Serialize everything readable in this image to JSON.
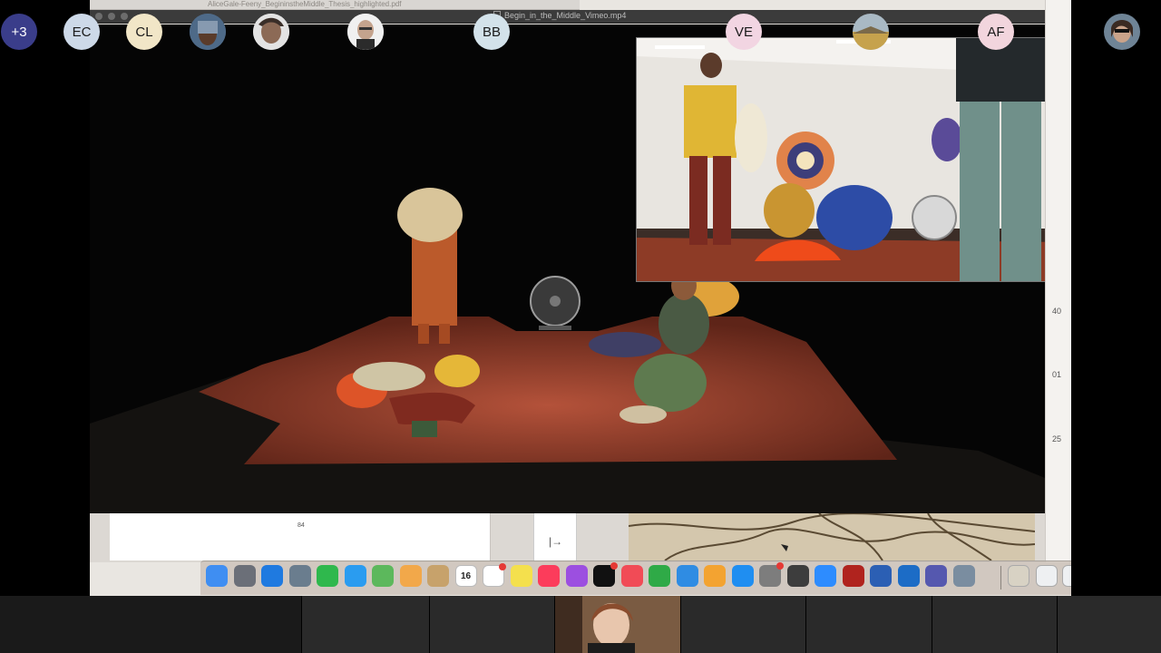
{
  "pdf_window": {
    "title": "AliceGale-Feeny_BegininstheMiddle_Thesis_highlighted.pdf"
  },
  "video_window": {
    "title": "Begin_in_the_Middle_Vimeo.mp4"
  },
  "pdf": {
    "page_number": "84",
    "side_numbers": [
      "40",
      "01",
      "25"
    ],
    "toolbar_glyph": "|→"
  },
  "dock": {
    "calendar_day": "16",
    "apps": [
      {
        "name": "Finder",
        "color": "#3f8ef2"
      },
      {
        "name": "Launchpad",
        "color": "#6b6f78"
      },
      {
        "name": "Safari",
        "color": "#1f7ae0"
      },
      {
        "name": "Preview",
        "color": "#6a7d8e"
      },
      {
        "name": "FaceTime",
        "color": "#2fb84d"
      },
      {
        "name": "Messages",
        "color": "#2a9cf0"
      },
      {
        "name": "Maps",
        "color": "#5cb85c"
      },
      {
        "name": "Photos",
        "color": "#f2a84a"
      },
      {
        "name": "Notes app",
        "color": "#c7a26b"
      },
      {
        "name": "Calendar",
        "color": "#ffffff"
      },
      {
        "name": "Reminders",
        "color": "#ffffff"
      },
      {
        "name": "Stickies",
        "color": "#f4e04d"
      },
      {
        "name": "Music",
        "color": "#fc3c5b"
      },
      {
        "name": "Podcasts",
        "color": "#9c4fe0"
      },
      {
        "name": "TV",
        "color": "#111111"
      },
      {
        "name": "News",
        "color": "#f14b56"
      },
      {
        "name": "Numbers",
        "color": "#2faa47"
      },
      {
        "name": "Keynote",
        "color": "#2f8ce3"
      },
      {
        "name": "Pages",
        "color": "#f3a331"
      },
      {
        "name": "App Store",
        "color": "#1f8ef1"
      },
      {
        "name": "System Preferences",
        "color": "#7d7d7d"
      },
      {
        "name": "QuickTime",
        "color": "#3d3d3d"
      },
      {
        "name": "Zoom",
        "color": "#2d8cff"
      },
      {
        "name": "Acrobat",
        "color": "#b0231e"
      },
      {
        "name": "Word",
        "color": "#2b5fb4"
      },
      {
        "name": "Outlook",
        "color": "#1c6cc6"
      },
      {
        "name": "Teams",
        "color": "#5558af"
      },
      {
        "name": "Preview 2",
        "color": "#7a8da0"
      }
    ]
  },
  "participants": [
    {
      "initials": "+3",
      "bg": "#3a3d8a",
      "fg": "#ffffff"
    },
    {
      "initials": "EC",
      "bg": "#cdd9e8"
    },
    {
      "initials": "CL",
      "bg": "#f1e6c7"
    },
    {
      "initials": "BB",
      "bg": "#d3e2ea"
    },
    {
      "initials": "VE",
      "bg": "#f2d5e2"
    },
    {
      "initials": "AF",
      "bg": "#f2d5dd"
    }
  ]
}
